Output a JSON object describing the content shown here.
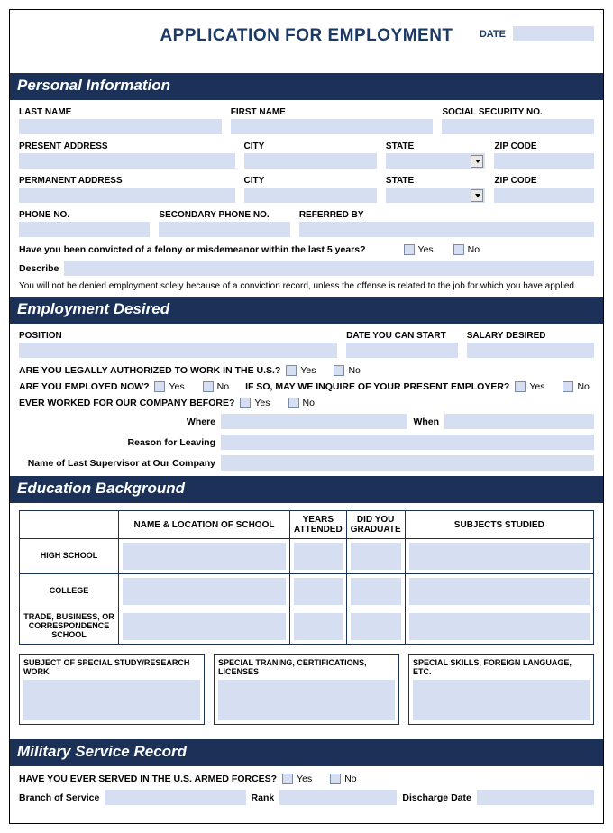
{
  "header": {
    "title": "APPLICATION FOR EMPLOYMENT",
    "date_label": "DATE"
  },
  "sections": {
    "personal": "Personal Information",
    "employment": "Employment Desired",
    "education": "Education Background",
    "military": "Military Service Record"
  },
  "personal": {
    "last_name": "LAST NAME",
    "first_name": "FIRST NAME",
    "ssn": "SOCIAL SECURITY NO.",
    "present_address": "PRESENT ADDRESS",
    "city": "CITY",
    "state": "STATE",
    "zip": "ZIP CODE",
    "permanent_address": "PERMANENT ADDRESS",
    "phone": "PHONE NO.",
    "secondary_phone": "SECONDARY PHONE NO.",
    "referred_by": "REFERRED BY",
    "felony_q": "Have you been convicted of a felony or misdemeanor within the last 5 years?",
    "yes": "Yes",
    "no": "No",
    "describe": "Describe",
    "disclaimer": "You will not be denied employment solely because of a conviction record, unless the offense is related to the job for which you have applied."
  },
  "employment": {
    "position": "POSITION",
    "date_start": "DATE YOU CAN START",
    "salary": "SALARY DESIRED",
    "authorized": "ARE YOU LEGALLY AUTHORIZED TO WORK IN THE U.S.?",
    "employed_now": "ARE YOU EMPLOYED NOW?",
    "inquire": "IF SO, MAY WE INQUIRE OF YOUR PRESENT EMPLOYER?",
    "worked_before": "EVER WORKED FOR OUR COMPANY BEFORE?",
    "where": "Where",
    "when": "When",
    "reason_leaving": "Reason for Leaving",
    "supervisor": "Name of Last Supervisor at Our Company",
    "yes": "Yes",
    "no": "No"
  },
  "education": {
    "headers": {
      "name_loc": "NAME & LOCATION OF SCHOOL",
      "years": "YEARS ATTENDED",
      "graduate": "DID YOU GRADUATE",
      "subjects": "SUBJECTS STUDIED"
    },
    "rows": {
      "high_school": "HIGH SCHOOL",
      "college": "COLLEGE",
      "trade": "TRADE, BUSINESS, OR CORRESPONDENCE SCHOOL"
    },
    "boxes": {
      "subject": "SUBJECT OF SPECIAL STUDY/RESEARCH WORK",
      "training": "SPECIAL TRANING, CERTIFICATIONS, LICENSES",
      "skills": "SPECIAL SKILLS, FOREIGN LANGUAGE, ETC."
    }
  },
  "military": {
    "served_q": "HAVE YOU EVER SERVED IN THE U.S. ARMED FORCES?",
    "yes": "Yes",
    "no": "No",
    "branch": "Branch of Service",
    "rank": "Rank",
    "discharge": "Discharge Date"
  }
}
